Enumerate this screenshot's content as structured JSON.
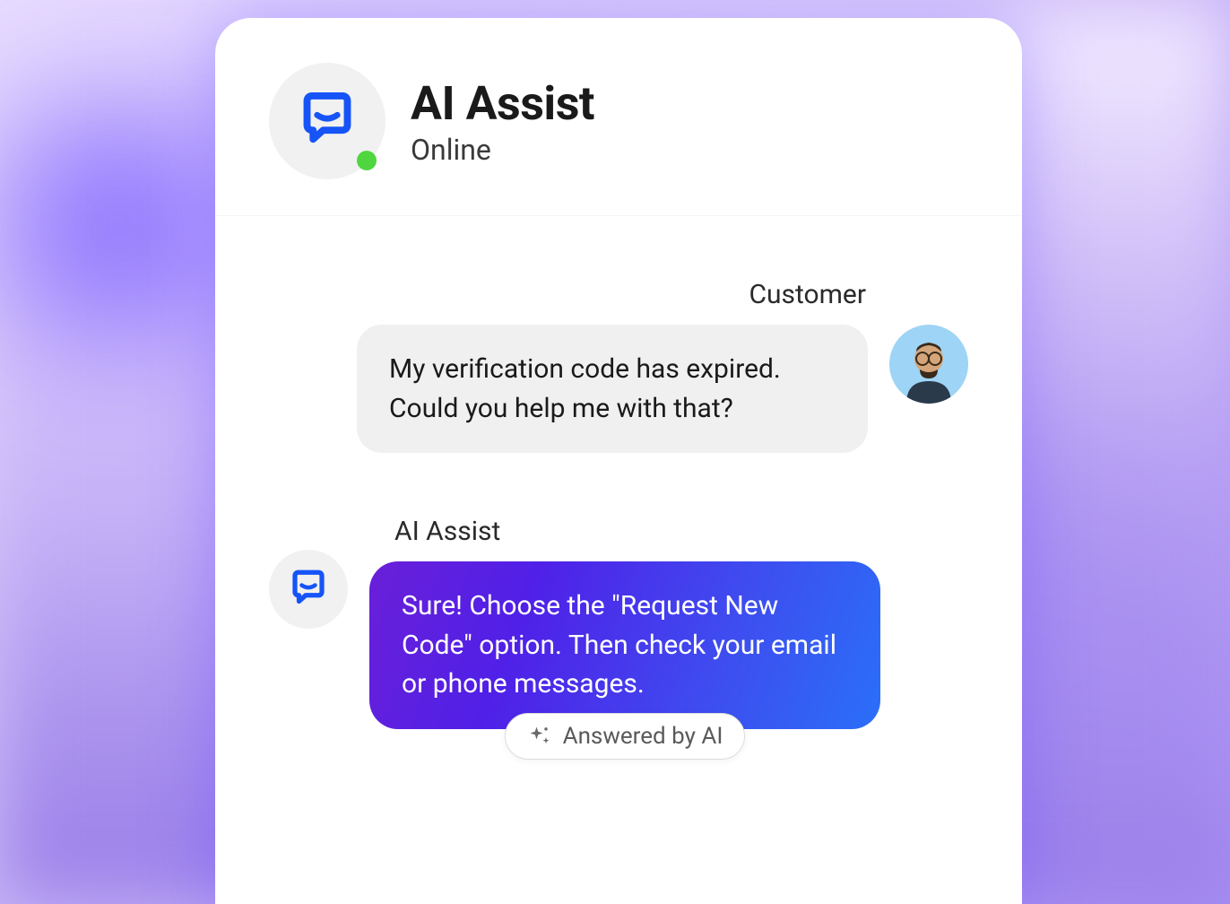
{
  "header": {
    "title": "AI Assist",
    "status": "Online"
  },
  "messages": {
    "customer": {
      "label": "Customer",
      "text": "My verification code has expired. Could you help me with that?"
    },
    "ai": {
      "label": "AI Assist",
      "text": "Sure! Choose the \"Request New Code\" option. Then check your email or phone messages.",
      "badge": "Answered by AI"
    }
  },
  "colors": {
    "accent_blue": "#1754f7",
    "status_green": "#4fd63f",
    "ai_gradient_start": "#6a1fd8",
    "ai_gradient_end": "#2a6ff8"
  }
}
